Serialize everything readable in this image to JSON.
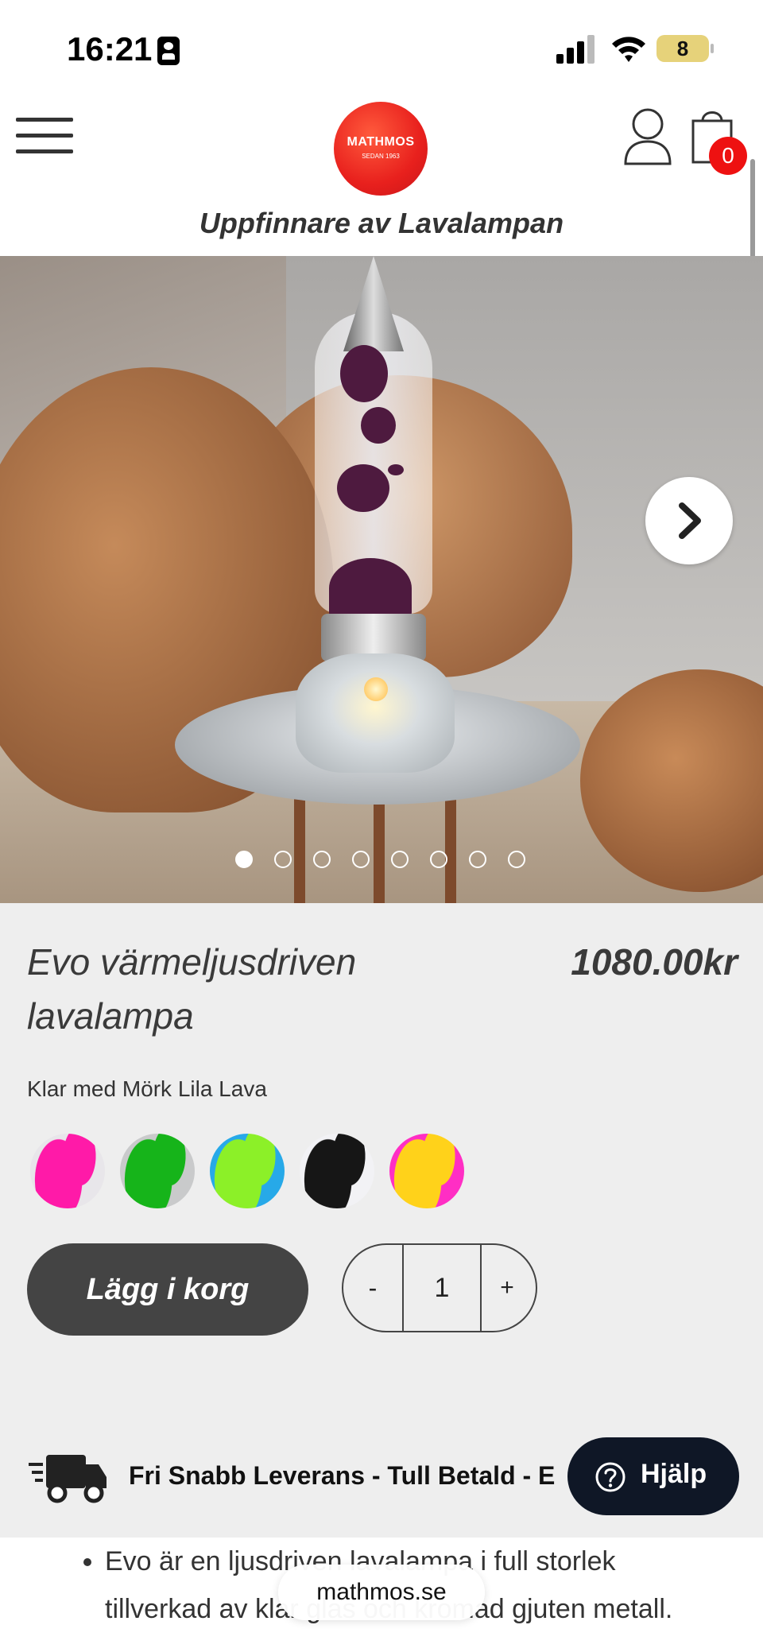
{
  "status_bar": {
    "time": "16:21",
    "battery": "8"
  },
  "header": {
    "logo_text": "MATHMOS",
    "logo_sub": "SEDAN 1963",
    "tagline": "Uppfinnare av Lavalampan",
    "cart_count": "0"
  },
  "carousel": {
    "slide_count": 8,
    "active_index": 0
  },
  "product": {
    "title": "Evo värmeljusdriven lavalampa",
    "price": "1080.00kr",
    "variant_label": "Klar med Mörk Lila Lava",
    "swatches": [
      {
        "name": "pink",
        "colors": [
          "#e8e6ea",
          "#ff1aa8"
        ]
      },
      {
        "name": "green",
        "colors": [
          "#c9cacb",
          "#16b41a"
        ]
      },
      {
        "name": "blue-lime",
        "colors": [
          "#27a9e8",
          "#8cf028"
        ]
      },
      {
        "name": "black",
        "colors": [
          "#f2f2f5",
          "#161616"
        ]
      },
      {
        "name": "pink-yellow",
        "colors": [
          "#ff2ec4",
          "#ffd21a"
        ]
      }
    ],
    "add_to_cart": "Lägg i korg",
    "quantity": "1",
    "qty_minus": "-",
    "qty_plus": "+"
  },
  "delivery": {
    "text": "Fri Snabb Leverans - Tull Betald - E"
  },
  "help": {
    "label": "Hjälp"
  },
  "description": {
    "items": [
      "Evo är en ljusdriven lavalampa i full storlek tillverkad av klar glas och kromad gjuten metall."
    ]
  },
  "browser": {
    "url": "mathmos.se"
  },
  "colors": {
    "accent": "#444444",
    "badge": "#ee1111",
    "help_bg": "#0f1726"
  }
}
